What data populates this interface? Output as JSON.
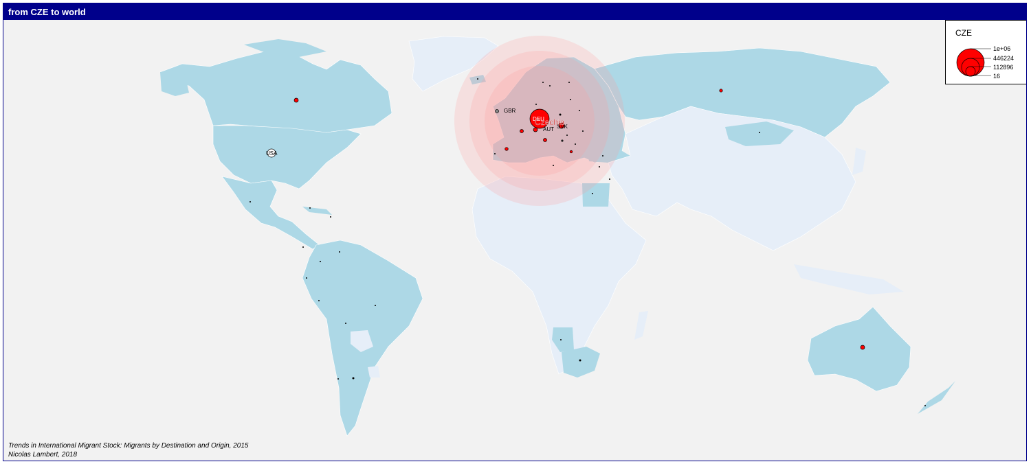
{
  "title": "from CZE to world",
  "legend": {
    "title": "CZE",
    "values": [
      "1e+06",
      "446224",
      "112896",
      "16"
    ]
  },
  "origin": {
    "label": "Czechia",
    "code": "CZE"
  },
  "labels": {
    "usa": "USA",
    "gbr": "GBR",
    "deu": "DEU",
    "aut": "AUT",
    "svk": "SVK"
  },
  "colors": {
    "land_highlight": "#add8e6",
    "land_other": "#e6eef8",
    "ocean": "#f2f2f2",
    "symbol": "#ff0000",
    "frame": "#00008b"
  },
  "source": {
    "line1": "Trends in International Migrant Stock: Migrants by Destination and Origin, 2015",
    "line2": "Nicolas Lambert, 2018"
  }
}
